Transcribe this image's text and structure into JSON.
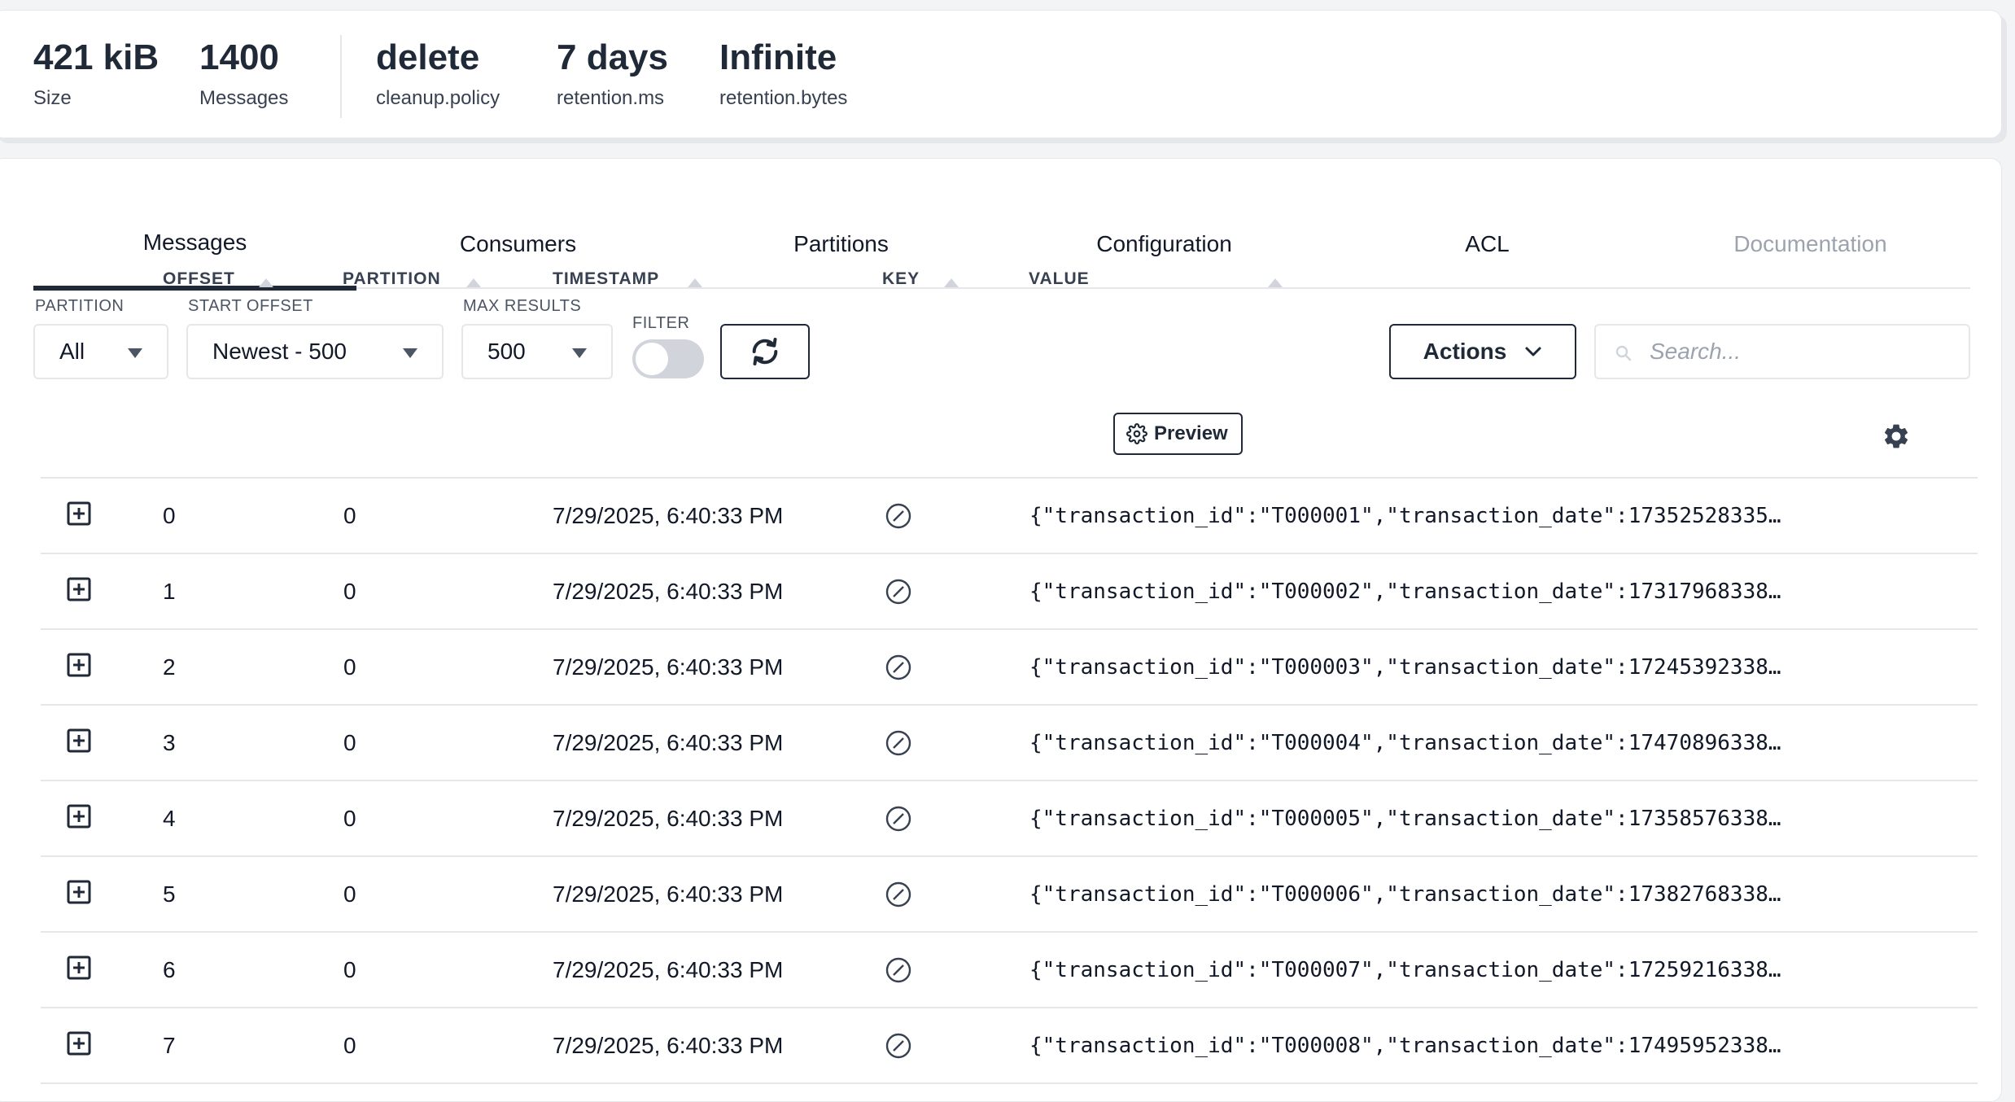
{
  "stats": [
    {
      "value": "421 kiB",
      "label": "Size"
    },
    {
      "value": "1400",
      "label": "Messages"
    },
    {
      "value": "delete",
      "label": "cleanup.policy"
    },
    {
      "value": "7 days",
      "label": "retention.ms"
    },
    {
      "value": "Infinite",
      "label": "retention.bytes"
    }
  ],
  "tabs": [
    {
      "label": "Messages",
      "state": "active"
    },
    {
      "label": "Consumers",
      "state": "normal"
    },
    {
      "label": "Partitions",
      "state": "normal"
    },
    {
      "label": "Configuration",
      "state": "normal"
    },
    {
      "label": "ACL",
      "state": "normal"
    },
    {
      "label": "Documentation",
      "state": "disabled"
    }
  ],
  "filters": {
    "partition": {
      "label": "PARTITION",
      "value": "All"
    },
    "start_offset": {
      "label": "START OFFSET",
      "value": "Newest - 500"
    },
    "max_results": {
      "label": "MAX RESULTS",
      "value": "500"
    },
    "filter": {
      "label": "FILTER",
      "enabled": false
    },
    "refresh_icon": "refresh-icon"
  },
  "actions": {
    "label": "Actions"
  },
  "search": {
    "placeholder": "Search..."
  },
  "table": {
    "columns": {
      "offset": "OFFSET",
      "partition": "PARTITION",
      "timestamp": "TIMESTAMP",
      "key": "KEY",
      "value": "VALUE"
    },
    "preview_label": "Preview",
    "rows": [
      {
        "offset": "0",
        "partition": "0",
        "timestamp": "7/29/2025, 6:40:33 PM",
        "key": "null",
        "value": "{\"transaction_id\":\"T000001\",\"transaction_date\":17352528335…"
      },
      {
        "offset": "1",
        "partition": "0",
        "timestamp": "7/29/2025, 6:40:33 PM",
        "key": "null",
        "value": "{\"transaction_id\":\"T000002\",\"transaction_date\":17317968338…"
      },
      {
        "offset": "2",
        "partition": "0",
        "timestamp": "7/29/2025, 6:40:33 PM",
        "key": "null",
        "value": "{\"transaction_id\":\"T000003\",\"transaction_date\":17245392338…"
      },
      {
        "offset": "3",
        "partition": "0",
        "timestamp": "7/29/2025, 6:40:33 PM",
        "key": "null",
        "value": "{\"transaction_id\":\"T000004\",\"transaction_date\":17470896338…"
      },
      {
        "offset": "4",
        "partition": "0",
        "timestamp": "7/29/2025, 6:40:33 PM",
        "key": "null",
        "value": "{\"transaction_id\":\"T000005\",\"transaction_date\":17358576338…"
      },
      {
        "offset": "5",
        "partition": "0",
        "timestamp": "7/29/2025, 6:40:33 PM",
        "key": "null",
        "value": "{\"transaction_id\":\"T000006\",\"transaction_date\":17382768338…"
      },
      {
        "offset": "6",
        "partition": "0",
        "timestamp": "7/29/2025, 6:40:33 PM",
        "key": "null",
        "value": "{\"transaction_id\":\"T000007\",\"transaction_date\":17259216338…"
      },
      {
        "offset": "7",
        "partition": "0",
        "timestamp": "7/29/2025, 6:40:33 PM",
        "key": "null",
        "value": "{\"transaction_id\":\"T000008\",\"transaction_date\":17495952338…"
      }
    ]
  },
  "colors": {
    "primary": "#1f2937",
    "border": "#e5e7eb",
    "muted": "#9ca3af"
  }
}
